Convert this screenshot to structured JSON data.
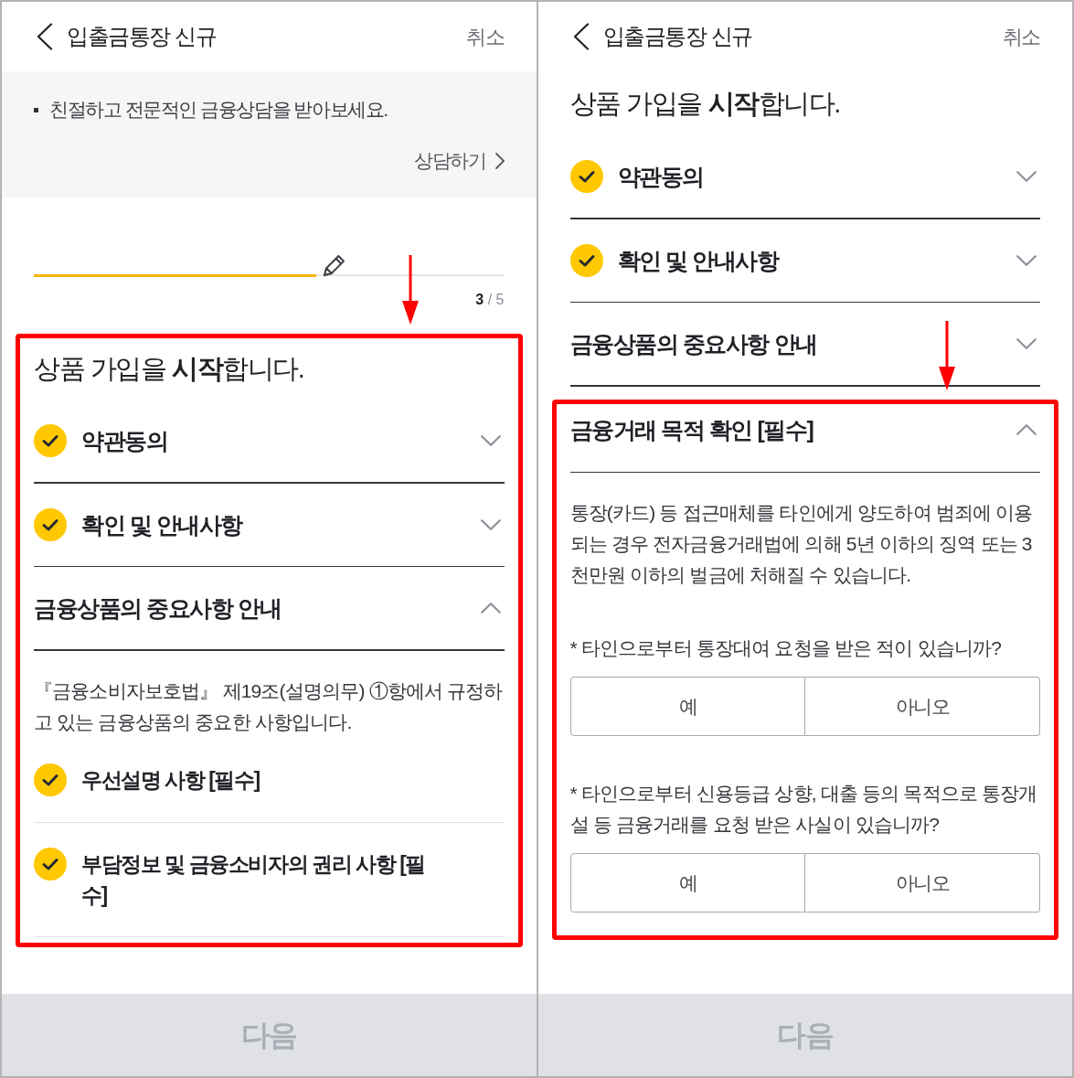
{
  "screens": [
    {
      "header": {
        "title": "입출금통장 신규",
        "cancel": "취소"
      },
      "consult_banner": {
        "message": "친절하고 전문적인 금융상담을 받아보세요.",
        "link": "상담하기"
      },
      "progress": {
        "level": 0.6,
        "step": "**3** / 5"
      },
      "content_highlighted": true,
      "heading": "상품 가입을 **시작**합니다.",
      "sections": [
        {
          "title": "약관동의",
          "checked": true,
          "expanded": false,
          "highlighted": false
        },
        {
          "title": "확인 및 안내사항",
          "checked": true,
          "expanded": false,
          "highlighted": false
        },
        {
          "title": "금융상품의 중요사항 안내",
          "checked": false,
          "expanded": true,
          "highlighted": false,
          "body": "『금융소비자보호법』 제19조(설명의무) ①항에서 규정하고 있는 금융상품의 중요한 사항입니다.",
          "subitems": [
            {
              "title": "우선설명 사항 [필수]",
              "checked": true
            },
            {
              "title": "부담정보 및 금융소비자의 권리 사항 [필수]",
              "checked": true
            }
          ]
        }
      ],
      "next_button": {
        "label": "다음",
        "disabled": true
      }
    },
    {
      "header": {
        "title": "입출금통장 신규",
        "cancel": "취소"
      },
      "content_highlighted": false,
      "heading": "상품 가입을 **시작**합니다.",
      "sections": [
        {
          "title": "약관동의",
          "checked": true,
          "expanded": false,
          "highlighted": false
        },
        {
          "title": "확인 및 안내사항",
          "checked": true,
          "expanded": false,
          "highlighted": false
        },
        {
          "title": "금융상품의 중요사항 안내",
          "checked": false,
          "expanded": false,
          "highlighted": false
        },
        {
          "title": "금융거래 목적 확인 [필수]",
          "checked": false,
          "expanded": true,
          "highlighted": true,
          "body": "통장(카드) 등 접근매체를 타인에게 양도하여 범죄에 이용되는 경우 전자금융거래법에 의해 5년 이하의 징역 또는 3천만원 이하의 벌금에 처해질 수 있습니다.",
          "questions": [
            {
              "text": "* 타인으로부터 통장대여 요청을 받은 적이 있습니까?",
              "options": [
                {
                  "label": "예",
                  "selected": false
                },
                {
                  "label": "아니오",
                  "selected": false
                }
              ]
            },
            {
              "text": "* 타인으로부터 신용등급 상향, 대출 등의 목적으로 통장개설 등 금융거래를 요청 받은 사실이 있습니까?",
              "options": [
                {
                  "label": "예",
                  "selected": false
                },
                {
                  "label": "아니오",
                  "selected": false
                }
              ]
            }
          ]
        }
      ],
      "next_button": {
        "label": "다음",
        "disabled": true
      }
    }
  ]
}
